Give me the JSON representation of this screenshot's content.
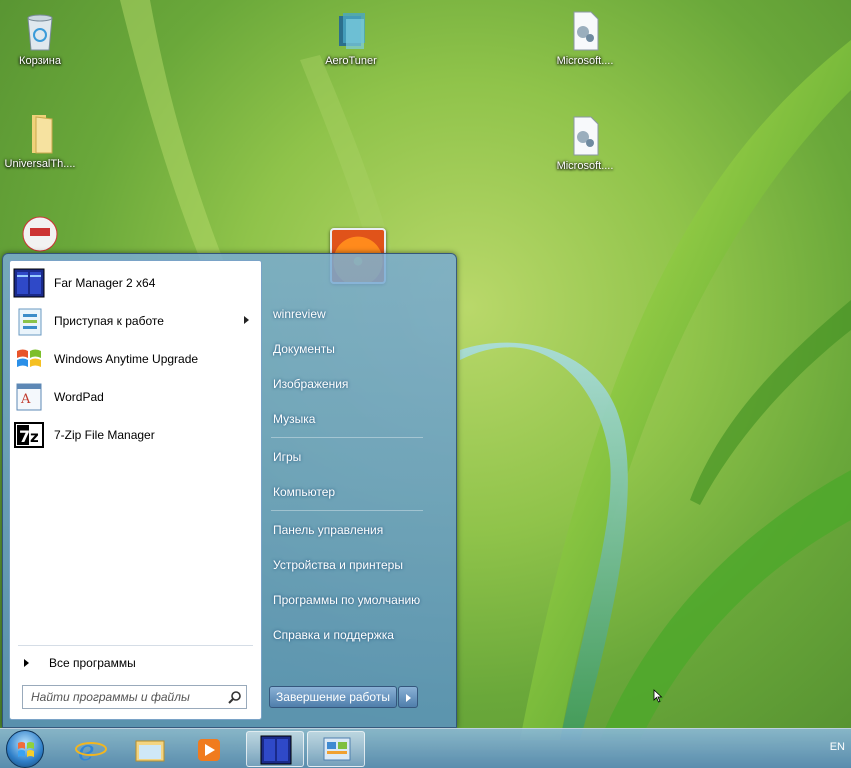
{
  "desktop": {
    "icons": [
      {
        "label": "Корзина",
        "icon": "recycle-bin-icon"
      },
      {
        "label": "AeroTuner",
        "icon": "aerotuner-icon"
      },
      {
        "label": "Microsoft....",
        "icon": "settings-file-icon"
      },
      {
        "label": "UniversalTh....",
        "icon": "folder-icon"
      },
      {
        "label": "Microsoft....",
        "icon": "settings-file-icon"
      },
      {
        "label": "",
        "icon": "nsis-installer-icon"
      }
    ]
  },
  "start_menu": {
    "programs": [
      {
        "label": "Far Manager 2 x64",
        "icon": "far-manager-icon",
        "has_submenu": false
      },
      {
        "label": "Приступая к работе",
        "icon": "getting-started-icon",
        "has_submenu": true
      },
      {
        "label": "Windows Anytime Upgrade",
        "icon": "windows-flag-icon",
        "has_submenu": false
      },
      {
        "label": "WordPad",
        "icon": "wordpad-icon",
        "has_submenu": false
      },
      {
        "label": "7-Zip File Manager",
        "icon": "seven-zip-icon",
        "has_submenu": false
      }
    ],
    "all_programs": "Все программы",
    "search_placeholder": "Найти программы и файлы",
    "right_items": [
      "winreview",
      "Документы",
      "Изображения",
      "Музыка",
      "Игры",
      "Компьютер",
      "Панель управления",
      "Устройства и принтеры",
      "Программы по умолчанию",
      "Справка и поддержка"
    ],
    "shutdown_label": "Завершение работы"
  },
  "taskbar": {
    "items": [
      "start-orb",
      "internet-explorer-icon",
      "explorer-folder-icon",
      "media-player-icon",
      "far-manager-icon",
      "control-panel-icon"
    ],
    "language": "EN"
  }
}
